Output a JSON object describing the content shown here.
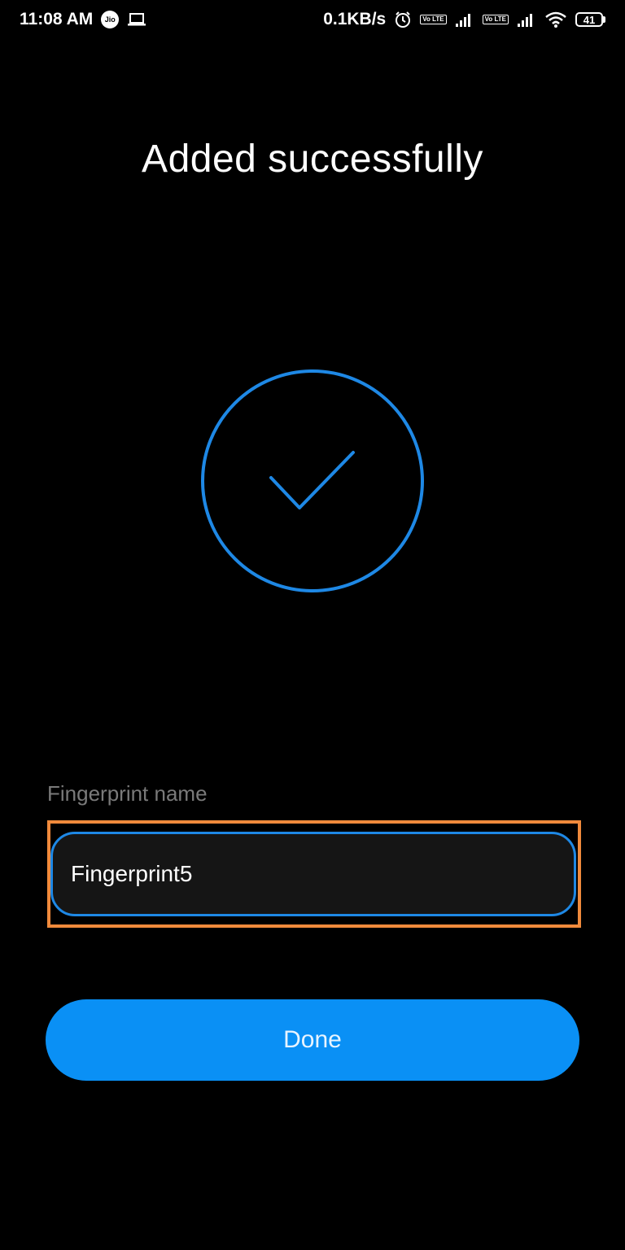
{
  "status_bar": {
    "time": "11:08 AM",
    "carrier_badge": "Jio",
    "network_speed": "0.1KB/s",
    "volte_label_1": "Vo LTE",
    "volte_label_2": "Vo LTE",
    "battery_level": "41",
    "icons": [
      "jio-icon",
      "laptop-icon",
      "alarm-icon",
      "volte-icon",
      "signal-icon",
      "volte-icon",
      "signal-icon",
      "wifi-icon",
      "battery-icon"
    ]
  },
  "main": {
    "title": "Added successfully",
    "success_icon": "checkmark-circle-icon",
    "accent_color": "#1e88e5"
  },
  "form": {
    "field_label": "Fingerprint name",
    "field_value": "Fingerprint5",
    "highlight_color": "#f08a3c"
  },
  "actions": {
    "done_label": "Done",
    "button_color": "#0a90f5"
  }
}
